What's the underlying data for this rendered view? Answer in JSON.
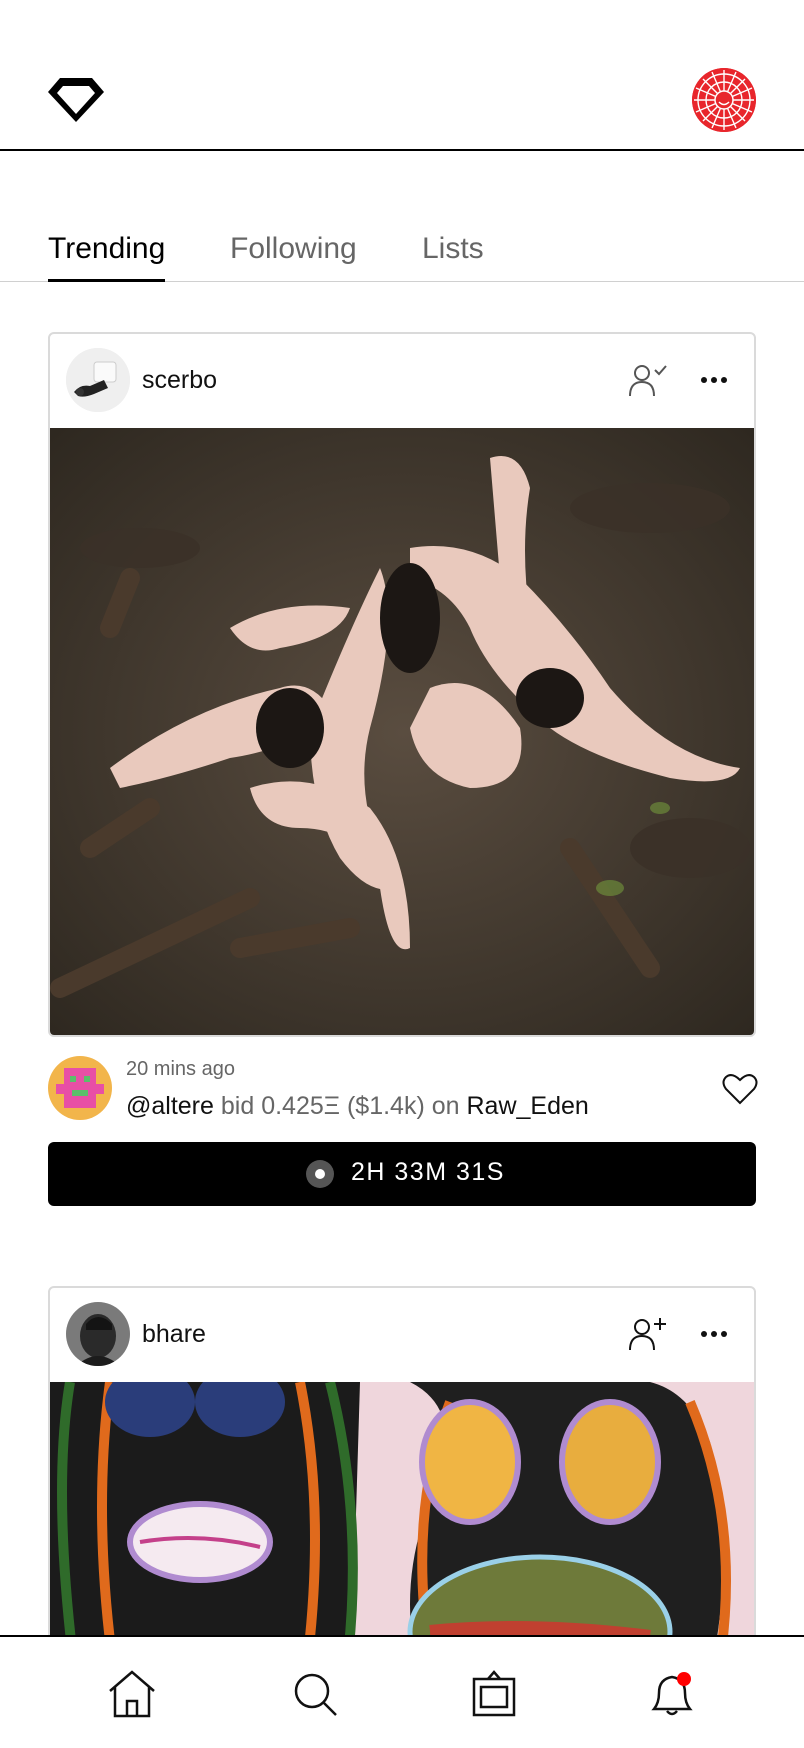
{
  "header": {
    "logo_icon": "diamond-logo-icon",
    "profile_icon": "profile-sun-avatar"
  },
  "tabs": [
    {
      "label": "Trending",
      "active": true
    },
    {
      "label": "Following",
      "active": false
    },
    {
      "label": "Lists",
      "active": false
    }
  ],
  "feed": [
    {
      "username": "scerbo",
      "follow_state": "following",
      "activity": {
        "time": "20 mins ago",
        "bidder": "@altere",
        "action": "bid",
        "amount": "0.425Ξ",
        "usd": "($1.4k)",
        "preposition": "on",
        "artwork": "Raw_Eden"
      },
      "timer": "2H 33M 31S"
    },
    {
      "username": "bhare",
      "follow_state": "not-following"
    }
  ],
  "nav": [
    {
      "name": "home",
      "icon": "home-icon"
    },
    {
      "name": "search",
      "icon": "search-icon"
    },
    {
      "name": "gallery",
      "icon": "frame-icon"
    },
    {
      "name": "notifications",
      "icon": "bell-icon",
      "badge": true
    }
  ],
  "colors": {
    "accent": "#000000",
    "notification_dot": "#ff0000",
    "profile_red": "#e8262c"
  }
}
